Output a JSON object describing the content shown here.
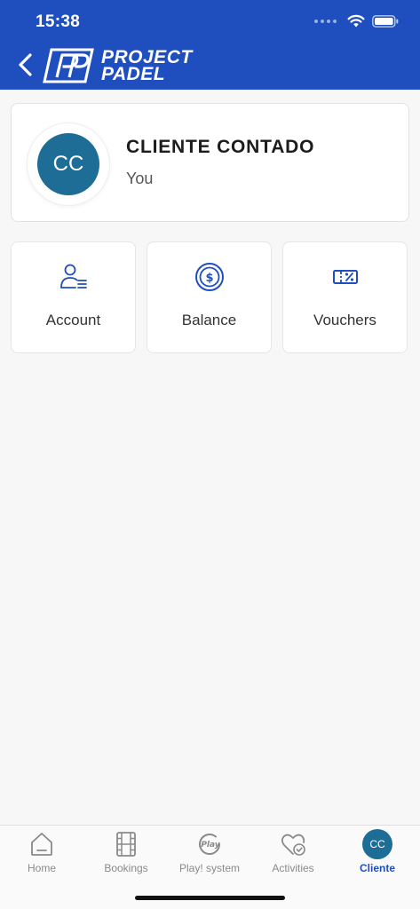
{
  "status_bar": {
    "time": "15:38"
  },
  "header": {
    "logo_line1": "PROJECT",
    "logo_line2": "PADEL"
  },
  "profile": {
    "initials": "CC",
    "name": "CLIENTE CONTADO",
    "subtitle": "You"
  },
  "tiles": [
    {
      "label": "Account",
      "icon": "account-icon"
    },
    {
      "label": "Balance",
      "icon": "balance-icon"
    },
    {
      "label": "Vouchers",
      "icon": "voucher-icon"
    }
  ],
  "tabbar": {
    "items": [
      {
        "label": "Home",
        "icon": "home-icon"
      },
      {
        "label": "Bookings",
        "icon": "bookings-icon"
      },
      {
        "label": "Play! system",
        "icon": "play-icon",
        "icon_text": "Play"
      },
      {
        "label": "Activities",
        "icon": "activities-icon"
      },
      {
        "label": "Cliente",
        "icon": "avatar",
        "initials": "CC",
        "active": true
      }
    ]
  },
  "colors": {
    "brand": "#1f4fbf",
    "avatar": "#1d6d97",
    "inactive": "#8a8a8a",
    "background": "#f7f7f7"
  }
}
